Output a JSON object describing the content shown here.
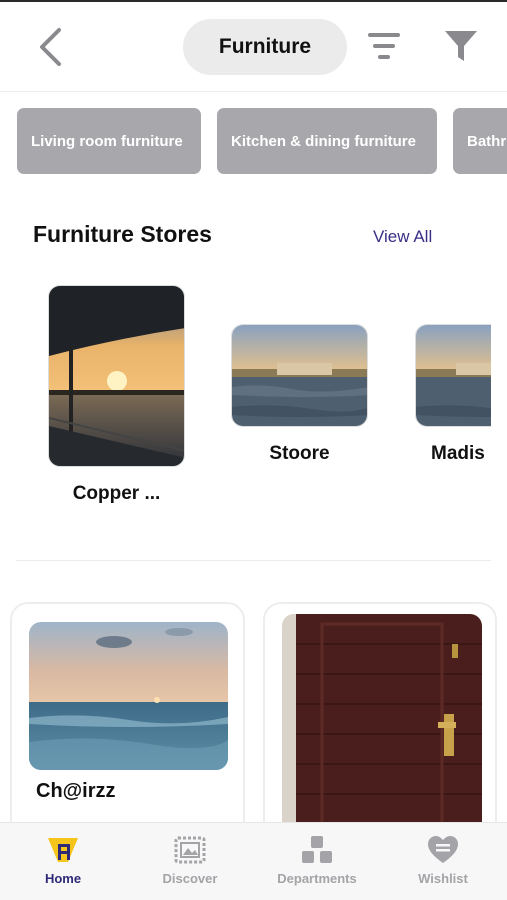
{
  "header": {
    "title": "Furniture",
    "back_icon": "chevron-left-icon",
    "sort_icon": "sort-lines-icon",
    "filter_icon": "funnel-icon"
  },
  "categories": [
    {
      "label": "Living room furniture"
    },
    {
      "label": "Kitchen & dining furniture"
    },
    {
      "label": "Bathr"
    }
  ],
  "stores_section": {
    "title": "Furniture Stores",
    "view_all": "View All",
    "stores": [
      {
        "name": "Copper ..."
      },
      {
        "name": "Stoore"
      },
      {
        "name": "Madis"
      }
    ]
  },
  "products": [
    {
      "name": "Ch@irzz"
    },
    {
      "name": ""
    }
  ],
  "bottom_nav": {
    "items": [
      {
        "label": "Home",
        "icon": "home-icon",
        "active": true
      },
      {
        "label": "Discover",
        "icon": "picture-frame-icon",
        "active": false
      },
      {
        "label": "Departments",
        "icon": "blocks-icon",
        "active": false
      },
      {
        "label": "Wishlist",
        "icon": "heart-icon",
        "active": false
      }
    ]
  },
  "colors": {
    "accent": "#2e2a78",
    "chip_bg": "#a8a8ac",
    "home_icon": "#f5c51c"
  }
}
